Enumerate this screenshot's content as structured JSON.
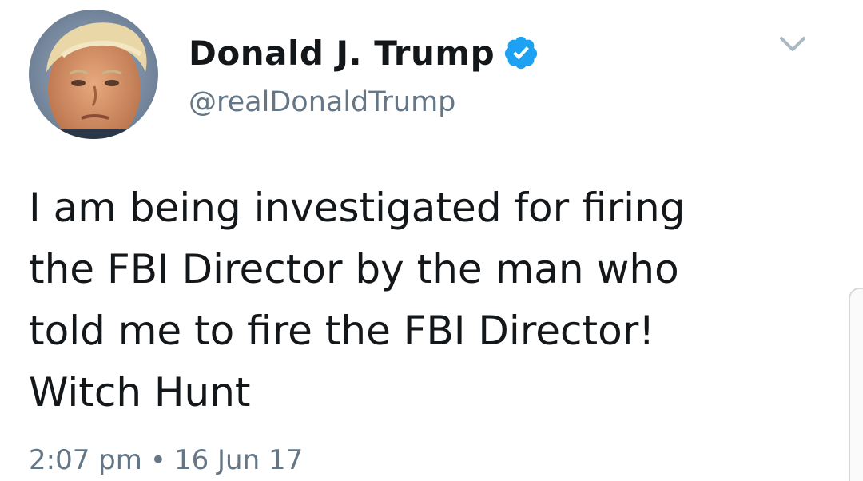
{
  "author": {
    "display_name": "Donald J. Trump",
    "handle": "@realDonaldTrump",
    "verified": true
  },
  "tweet": {
    "text": "I am being investigated for firing\nthe FBI Director by the man who\ntold me to fire the FBI Director!\nWitch Hunt",
    "time": "2:07 pm",
    "separator": "•",
    "date": "16 Jun 17"
  },
  "icons": {
    "verified": "verified-badge-icon",
    "menu": "chevron-down-icon"
  },
  "colors": {
    "verified_blue": "#1da1f2",
    "secondary_text": "#657786",
    "primary_text": "#14171a",
    "chevron": "#aab8c2"
  }
}
